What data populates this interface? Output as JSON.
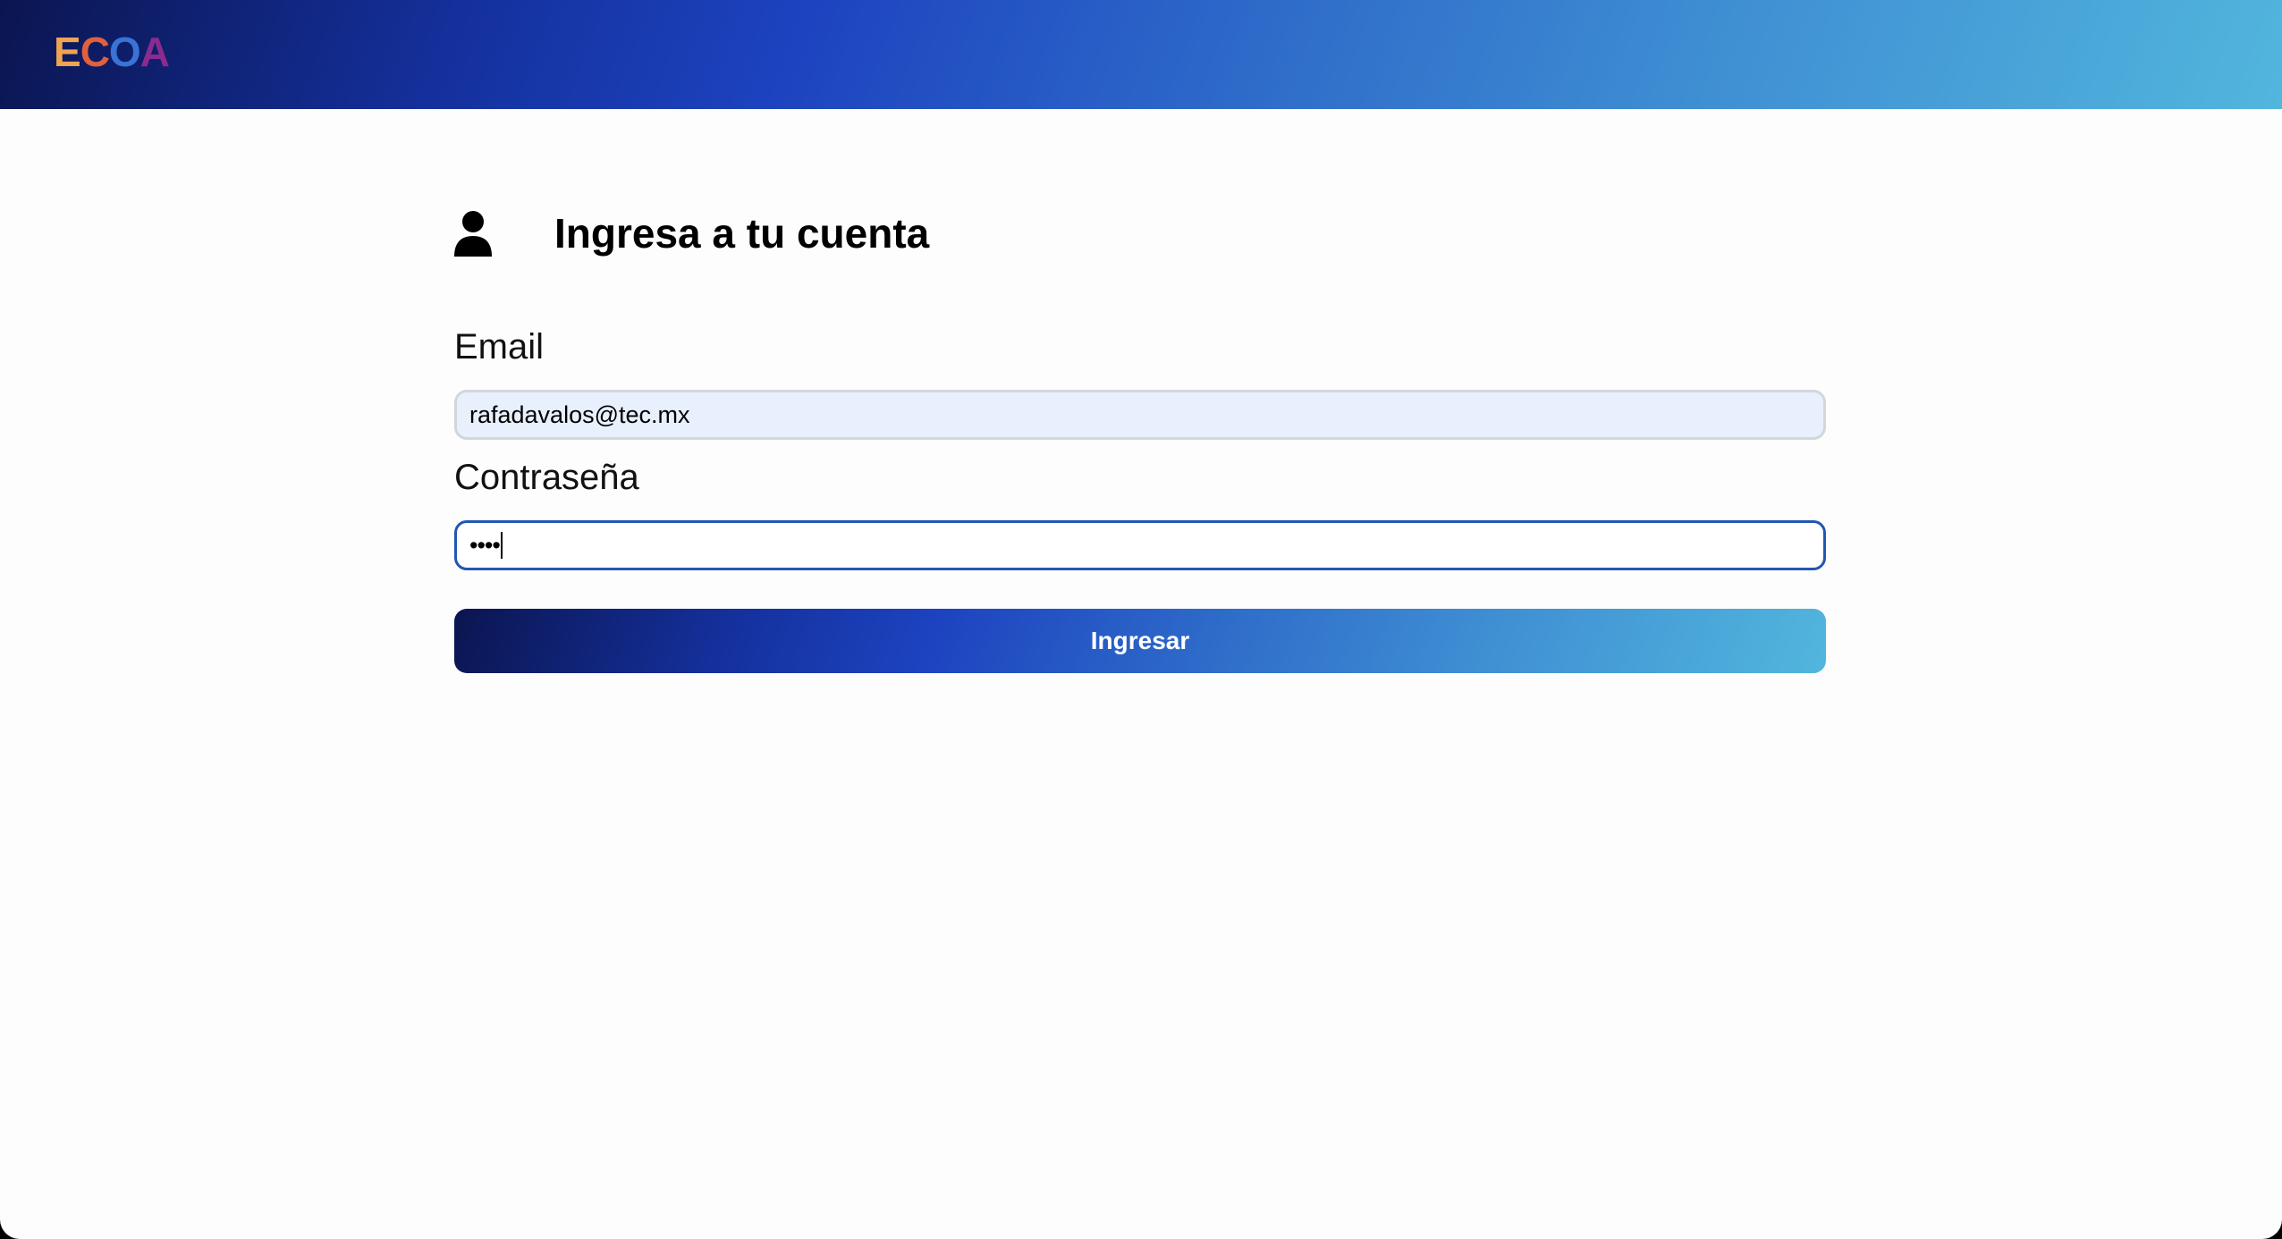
{
  "header": {
    "logo": {
      "letters": [
        "E",
        "C",
        "O",
        "A"
      ],
      "colors": [
        "#f0a451",
        "#e0603f",
        "#3a72d6",
        "#8a2b8f"
      ]
    },
    "gradient": [
      "#0b1550",
      "#1d43c0",
      "#52b6dd"
    ]
  },
  "login": {
    "icon": "user-icon",
    "title": "Ingresa a tu cuenta",
    "email_label": "Email",
    "email_value": "rafadavalos@tec.mx",
    "password_label": "Contraseña",
    "password_value": "••••",
    "submit_label": "Ingresar"
  }
}
